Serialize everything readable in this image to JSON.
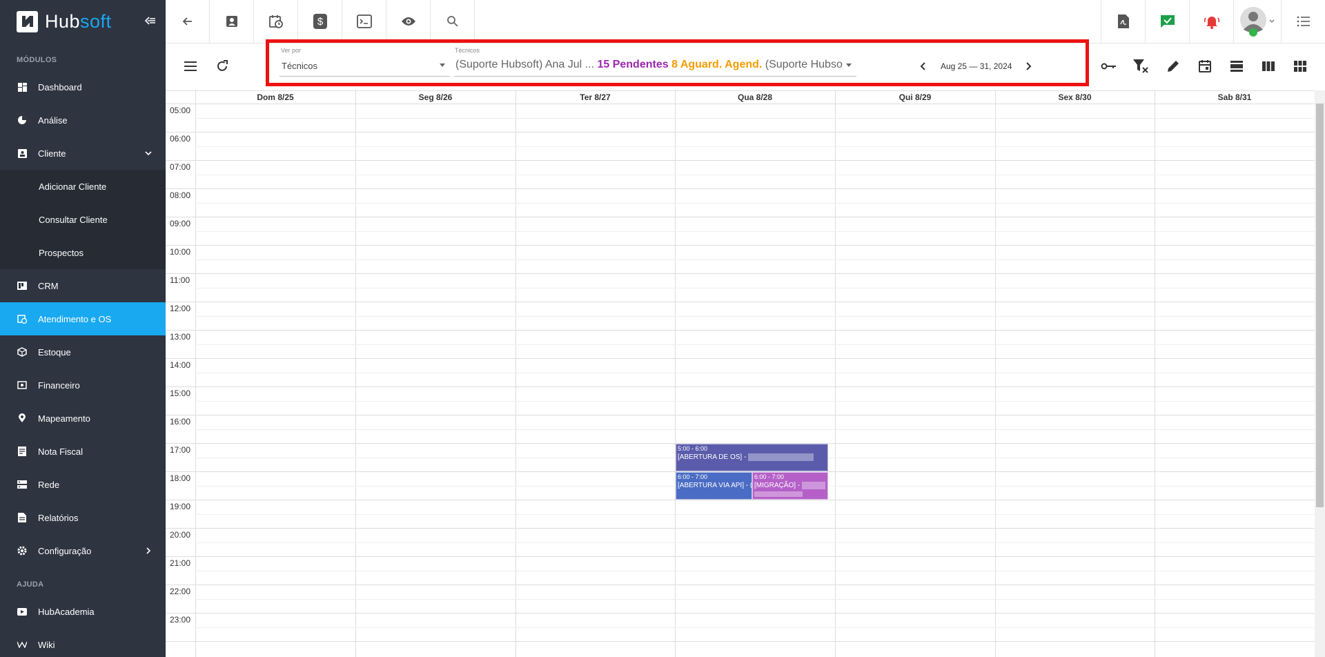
{
  "brand": {
    "hub": "Hub",
    "soft": "soft"
  },
  "sidebar": {
    "section_modules": "MÓDULOS",
    "section_help": "AJUDA",
    "items": [
      {
        "label": "Dashboard",
        "icon": "dashboard-icon"
      },
      {
        "label": "Análise",
        "icon": "pie-chart-icon"
      },
      {
        "label": "Cliente",
        "icon": "contact-card-icon"
      },
      {
        "label": "Adicionar Cliente"
      },
      {
        "label": "Consultar Cliente"
      },
      {
        "label": "Prospectos"
      },
      {
        "label": "CRM",
        "icon": "board-icon"
      },
      {
        "label": "Atendimento e OS",
        "icon": "calendar-clock-icon"
      },
      {
        "label": "Estoque",
        "icon": "box-icon"
      },
      {
        "label": "Financeiro",
        "icon": "money-icon"
      },
      {
        "label": "Mapeamento",
        "icon": "map-pin-icon"
      },
      {
        "label": "Nota Fiscal",
        "icon": "receipt-icon"
      },
      {
        "label": "Rede",
        "icon": "server-icon"
      },
      {
        "label": "Relatórios",
        "icon": "report-icon"
      },
      {
        "label": "Configuração",
        "icon": "gear-icon"
      },
      {
        "label": "HubAcademia",
        "icon": "youtube-icon"
      },
      {
        "label": "Wiki",
        "icon": "wiki-icon"
      }
    ]
  },
  "toolbar": {
    "ver_por_label": "Ver por",
    "ver_por_value": "Técnicos",
    "tecnicos_label": "Técnicos",
    "tecnicos_prefix": "(Suporte Hubsoft) Ana Jul ...",
    "pendentes": "15 Pendentes",
    "aguard": "8 Aguard. Agend.",
    "tecnicos_suffix": "(Suporte Hubso",
    "date_range": "Aug 25 — 31, 2024"
  },
  "calendar": {
    "days": [
      "Dom 8/25",
      "Seg 8/26",
      "Ter 8/27",
      "Qua 8/28",
      "Qui 8/29",
      "Sex 8/30",
      "Sab 8/31"
    ],
    "hours": [
      "05:00",
      "06:00",
      "07:00",
      "08:00",
      "09:00",
      "10:00",
      "11:00",
      "12:00",
      "13:00",
      "14:00",
      "15:00",
      "16:00",
      "17:00",
      "18:00",
      "19:00",
      "20:00",
      "21:00",
      "22:00",
      "23:00"
    ],
    "events": [
      {
        "time": "5:00 - 6:00",
        "title": "[ABERTURA DE OS] -",
        "color": "#5a5cab"
      },
      {
        "time": "6:00 - 7:00",
        "title": "[ABERTURA VIA API] - (",
        "color": "#4a6cc4"
      },
      {
        "time": "6:00 - 7:00",
        "title": "[MIGRAÇÃO] -",
        "color": "#b460c8"
      }
    ]
  },
  "colors": {
    "sidebar_bg": "#2e3440",
    "active": "#19a9f1",
    "purple": "#9b27b0",
    "orange": "#f59c00"
  }
}
